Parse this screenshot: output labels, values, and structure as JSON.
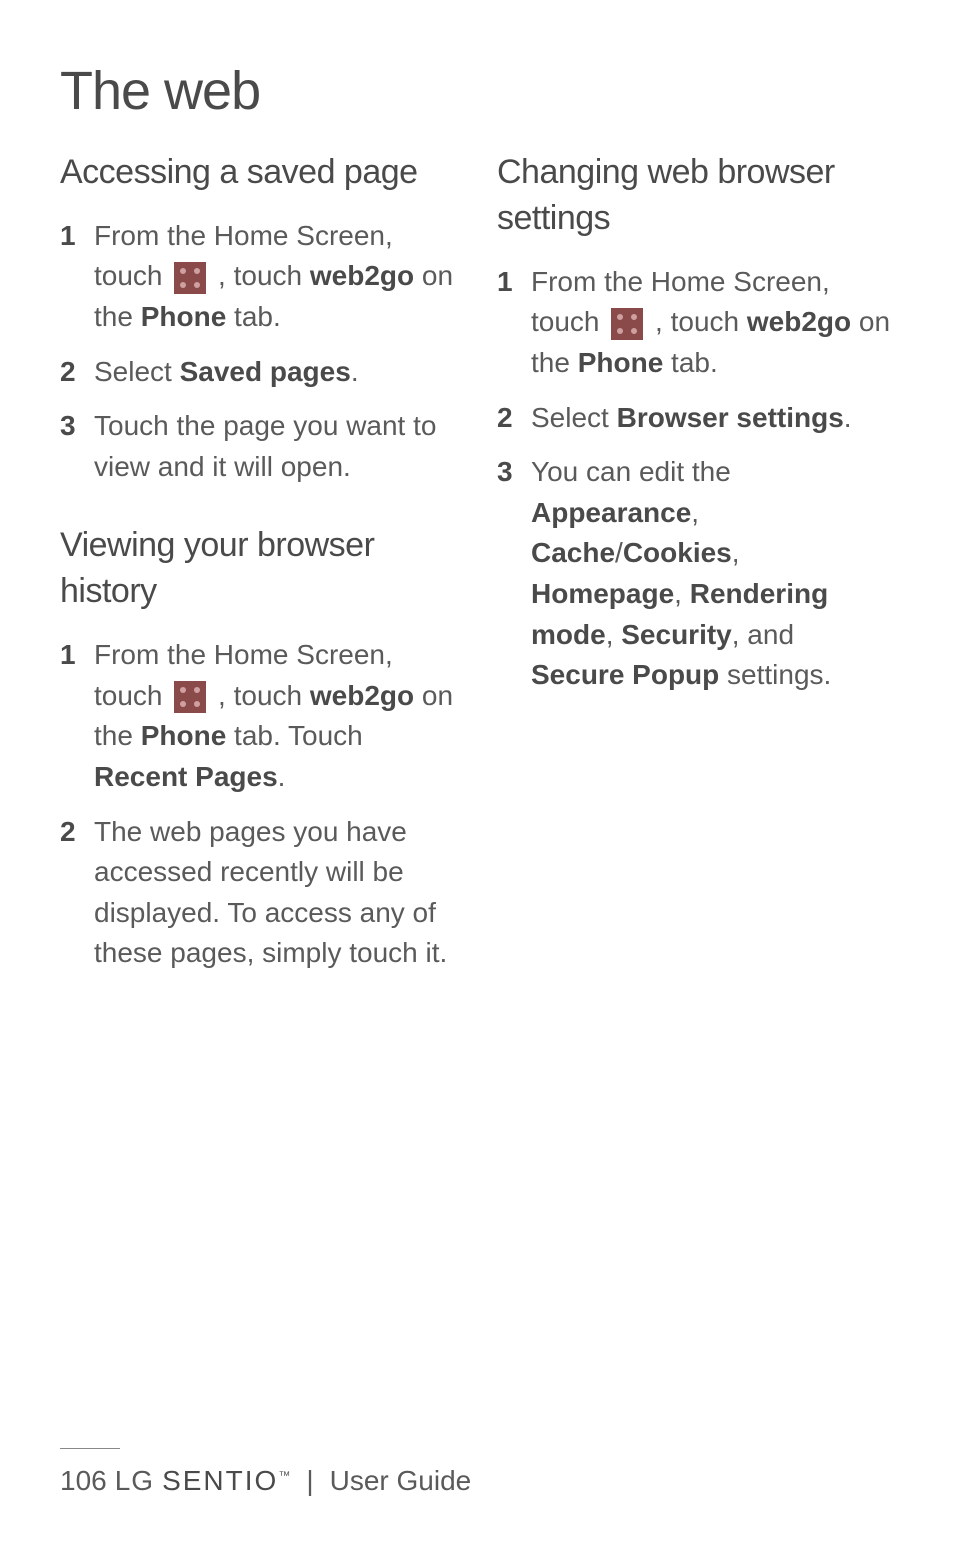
{
  "page_title": "The web",
  "left_column": {
    "section1": {
      "title": "Accessing a saved page",
      "items": [
        {
          "num": "1",
          "pre": "From the Home Screen, touch ",
          "mid": " , touch ",
          "bold1": "web2go",
          "mid2": " on the ",
          "bold2": "Phone",
          "post": " tab."
        },
        {
          "num": "2",
          "pre": "Select ",
          "bold1": "Saved pages",
          "post": "."
        },
        {
          "num": "3",
          "text": "Touch the page you want to view and it will open."
        }
      ]
    },
    "section2": {
      "title": "Viewing your browser history",
      "items": [
        {
          "num": "1",
          "pre": "From the Home Screen, touch ",
          "mid": " , touch ",
          "bold1": "web2go",
          "mid2": " on the ",
          "bold2": "Phone",
          "post": " tab. Touch ",
          "bold3": "Recent Pages",
          "post2": "."
        },
        {
          "num": "2",
          "text": "The web pages you have accessed recently will be displayed. To access any of these pages, simply touch it."
        }
      ]
    }
  },
  "right_column": {
    "section1": {
      "title": "Changing web browser settings",
      "items": [
        {
          "num": "1",
          "pre": "From the Home Screen, touch ",
          "mid": " , touch ",
          "bold1": "web2go",
          "mid2": " on the ",
          "bold2": "Phone",
          "post": " tab."
        },
        {
          "num": "2",
          "pre": "Select ",
          "bold1": "Browser settings",
          "post": "."
        },
        {
          "num": "3",
          "pre": "You can edit the ",
          "bold1": "Appearance",
          "mid": ", ",
          "bold2": "Cache",
          "mid2": "/",
          "bold3": "Cookies",
          "mid3": ", ",
          "bold4": "Homepage",
          "mid4": ", ",
          "bold5": "Rendering mode",
          "mid5": ", ",
          "bold6": "Security",
          "mid6": ", and ",
          "bold7": "Secure Popup",
          "post": " settings."
        }
      ]
    }
  },
  "footer": {
    "page_number": "106",
    "lg": "LG",
    "sentio": "SENTIO",
    "tm": "™",
    "divider": "|",
    "guide": "User Guide"
  }
}
